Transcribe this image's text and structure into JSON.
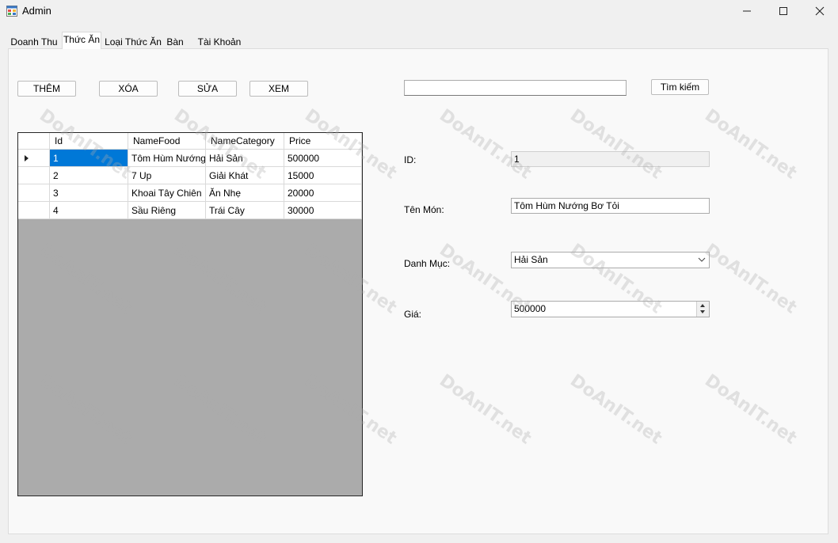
{
  "window": {
    "title": "Admin",
    "minimize_glyph": "—",
    "maximize_glyph": "☐",
    "close_glyph": "✕"
  },
  "tabs": [
    {
      "label": "Doanh Thu",
      "active": false
    },
    {
      "label": "Thức Ăn",
      "active": true
    },
    {
      "label": "Loại Thức Ăn",
      "active": false
    },
    {
      "label": "Bàn",
      "active": false
    },
    {
      "label": "Tài Khoản",
      "active": false
    }
  ],
  "toolbar": {
    "add_label": "THÊM",
    "delete_label": "XÓA",
    "edit_label": "SỬA",
    "view_label": "XEM"
  },
  "search": {
    "value": "",
    "button_label": "Tìm kiếm"
  },
  "grid": {
    "columns": [
      "Id",
      "NameFood",
      "NameCategory",
      "Price"
    ],
    "rows": [
      [
        "1",
        "Tôm Hùm Nướng...",
        "Hải Sản",
        "500000"
      ],
      [
        "2",
        "7 Up",
        "Giải Khát",
        "15000"
      ],
      [
        "3",
        "Khoai Tây Chiên",
        "Ăn Nhẹ",
        "20000"
      ],
      [
        "4",
        "Sầu Riêng",
        "Trái Cây",
        "30000"
      ]
    ],
    "selected_row": 0
  },
  "form": {
    "id_label": "ID:",
    "id_value": "1",
    "name_label": "Tên Món:",
    "name_value": "Tôm Hùm Nướng Bơ Tỏi",
    "category_label": "Danh Mục:",
    "category_value": "Hải Sản",
    "price_label": "Giá:",
    "price_value": "500000"
  },
  "watermark": {
    "text": "DoAnIT.net"
  },
  "colors": {
    "selection": "#0078d7",
    "grid_background": "#ababab"
  }
}
